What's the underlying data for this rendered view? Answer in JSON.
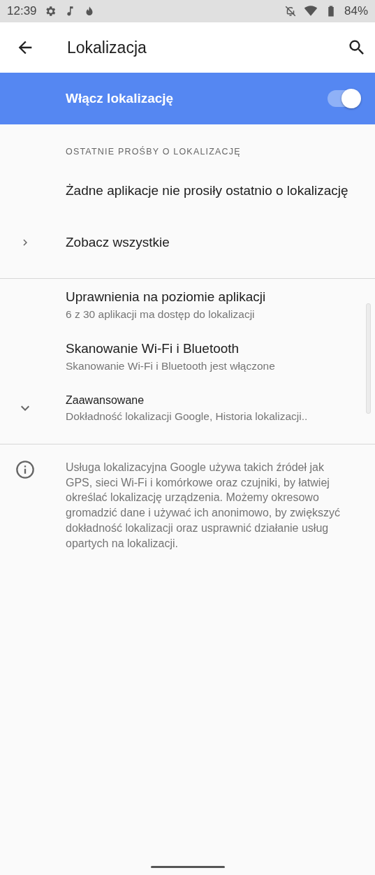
{
  "status_bar": {
    "time": "12:39",
    "battery": "84%"
  },
  "toolbar": {
    "title": "Lokalizacja"
  },
  "master_switch": {
    "label": "Włącz lokalizację",
    "on": true
  },
  "sections": [
    {
      "header": "OSTATNIE PROŚBY O LOKALIZACJĘ",
      "items": [
        {
          "kind": "text",
          "title": "Żadne aplikacje nie prosiły ostatnio o lokalizację"
        },
        {
          "kind": "link",
          "title": "Zobacz wszystkie"
        }
      ]
    },
    {
      "items": [
        {
          "kind": "setting",
          "title": "Uprawnienia na poziomie aplikacji",
          "summary": "6 z 30 aplikacji ma dostęp do lokalizacji"
        },
        {
          "kind": "setting",
          "title": "Skanowanie Wi-Fi i Bluetooth",
          "summary": "Skanowanie Wi-Fi i Bluetooth jest włączone"
        },
        {
          "kind": "expand",
          "title": "Zaawansowane",
          "summary": "Dokładność lokalizacji Google, Historia lokalizacji.."
        }
      ]
    }
  ],
  "footer": {
    "text": "Usługa lokalizacyjna Google używa takich źródeł jak GPS, sieci Wi-Fi i komórkowe oraz czujniki, by łatwiej określać lokalizację urządzenia. Możemy okresowo gromadzić dane i używać ich anonimowo, by zwiększyć dokładność lokalizacji oraz usprawnić działanie usług opartych na lokalizacji."
  }
}
